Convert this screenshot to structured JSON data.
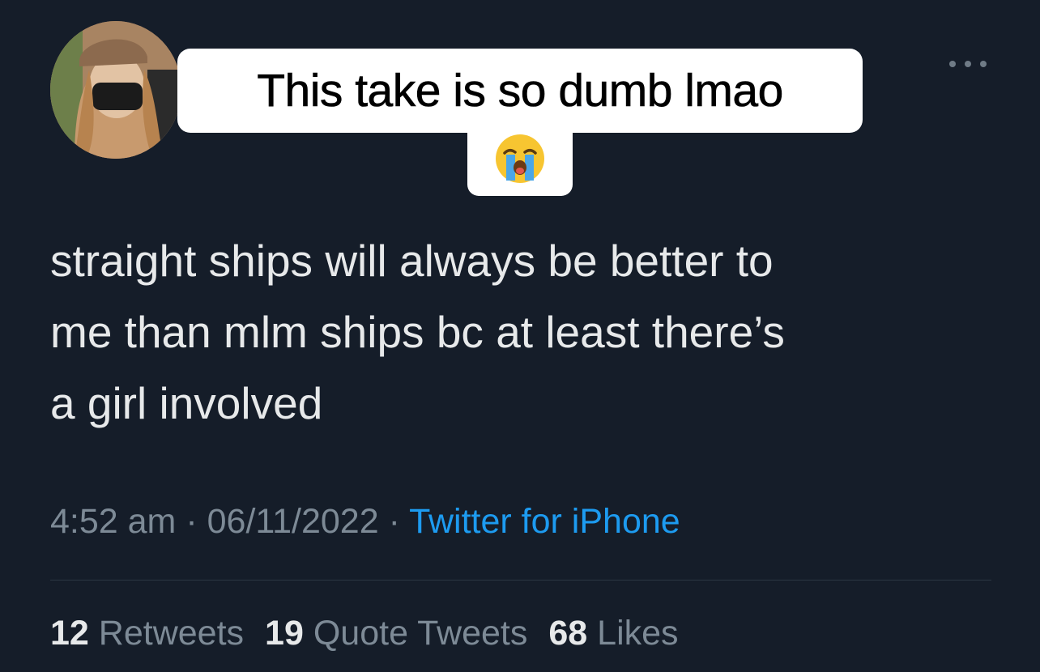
{
  "caption": {
    "text": "This take is so dumb lmao",
    "emoji": "😭",
    "emoji_name": "loudly-crying-face"
  },
  "tweet": {
    "lines": [
      "straight ships will always be better to",
      "me than mlm ships bc at least there’s",
      "a girl involved"
    ],
    "time": "4:52 am",
    "separator": "·",
    "date": "06/11/2022",
    "source": "Twitter for iPhone",
    "more_icon": "more-horizontal-icon"
  },
  "stats": {
    "retweets_count": "12",
    "retweets_label": "Retweets",
    "quotes_count": "19",
    "quotes_label": "Quote Tweets",
    "likes_count": "68",
    "likes_label": "Likes"
  },
  "colors": {
    "background": "#151d29",
    "text": "#e7e9ea",
    "muted": "#7d8a96",
    "link": "#1d9bf0",
    "caption_bg": "#ffffff"
  }
}
